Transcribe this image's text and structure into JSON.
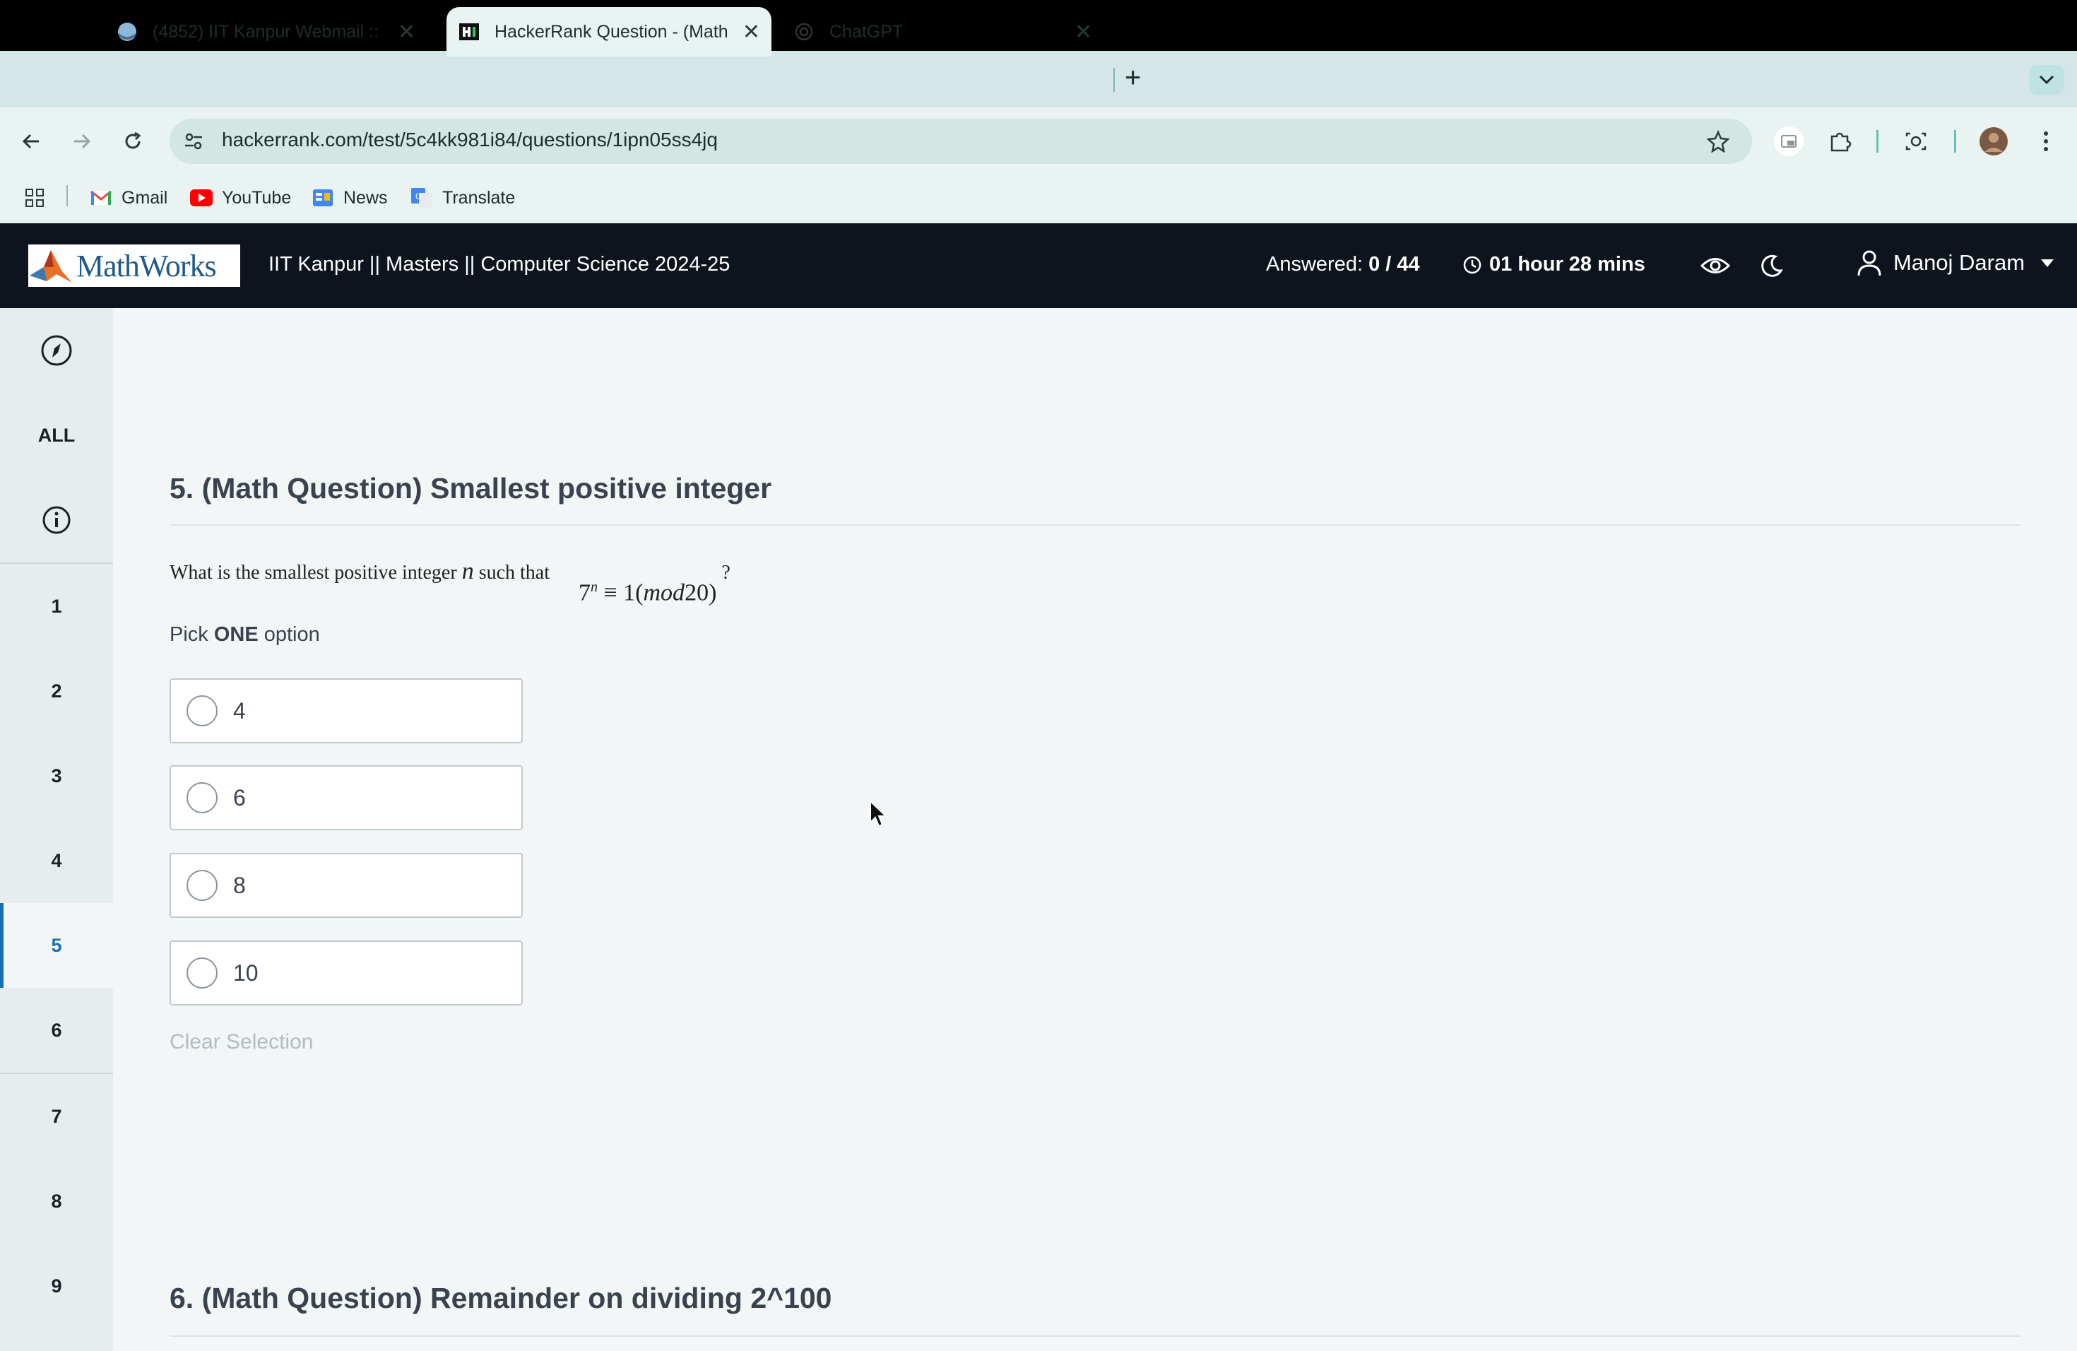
{
  "browser": {
    "tabs": [
      {
        "title": "(4852) IIT Kanpur Webmail ::",
        "favicon": "roundcube-icon",
        "active": false
      },
      {
        "title": "HackerRank Question - (Math",
        "favicon": "hackerrank-icon",
        "active": true
      },
      {
        "title": "ChatGPT",
        "favicon": "chatgpt-icon",
        "active": false
      }
    ],
    "new_tab": "+",
    "url": "hackerrank.com/test/5c4kk981i84/questions/1ipn05ss4jq",
    "bookmarks": [
      {
        "label": "Gmail",
        "icon": "gmail-icon"
      },
      {
        "label": "YouTube",
        "icon": "youtube-icon"
      },
      {
        "label": "News",
        "icon": "google-news-icon"
      },
      {
        "label": "Translate",
        "icon": "google-translate-icon"
      }
    ]
  },
  "header": {
    "logo": "MathWorks",
    "test_title": "IIT Kanpur || Masters || Computer Science 2024-25",
    "answered_label": "Answered:",
    "answered_value": "0 / 44",
    "timer": "01 hour 28 mins",
    "user_name": "Manoj Daram"
  },
  "sidenav": {
    "all_label": "ALL",
    "items": [
      "1",
      "2",
      "3",
      "4",
      "5",
      "6",
      "7",
      "8",
      "9"
    ],
    "active": "5"
  },
  "question5": {
    "title": "5. (Math Question) Smallest positive integer",
    "text_prefix": "What is the smallest positive integer ",
    "var": "n",
    "text_mid": " such that ",
    "math_base": "7",
    "math_exp": "n",
    "math_rest": " ≡ 1(",
    "math_mod": "mod",
    "math_num": "20)",
    "text_suffix": " ?",
    "pick_prefix": "Pick ",
    "pick_bold": "ONE",
    "pick_suffix": " option",
    "options": [
      "4",
      "6",
      "8",
      "10"
    ],
    "clear_label": "Clear Selection"
  },
  "question6": {
    "title": "6. (Math Question) Remainder on dividing 2^100"
  }
}
